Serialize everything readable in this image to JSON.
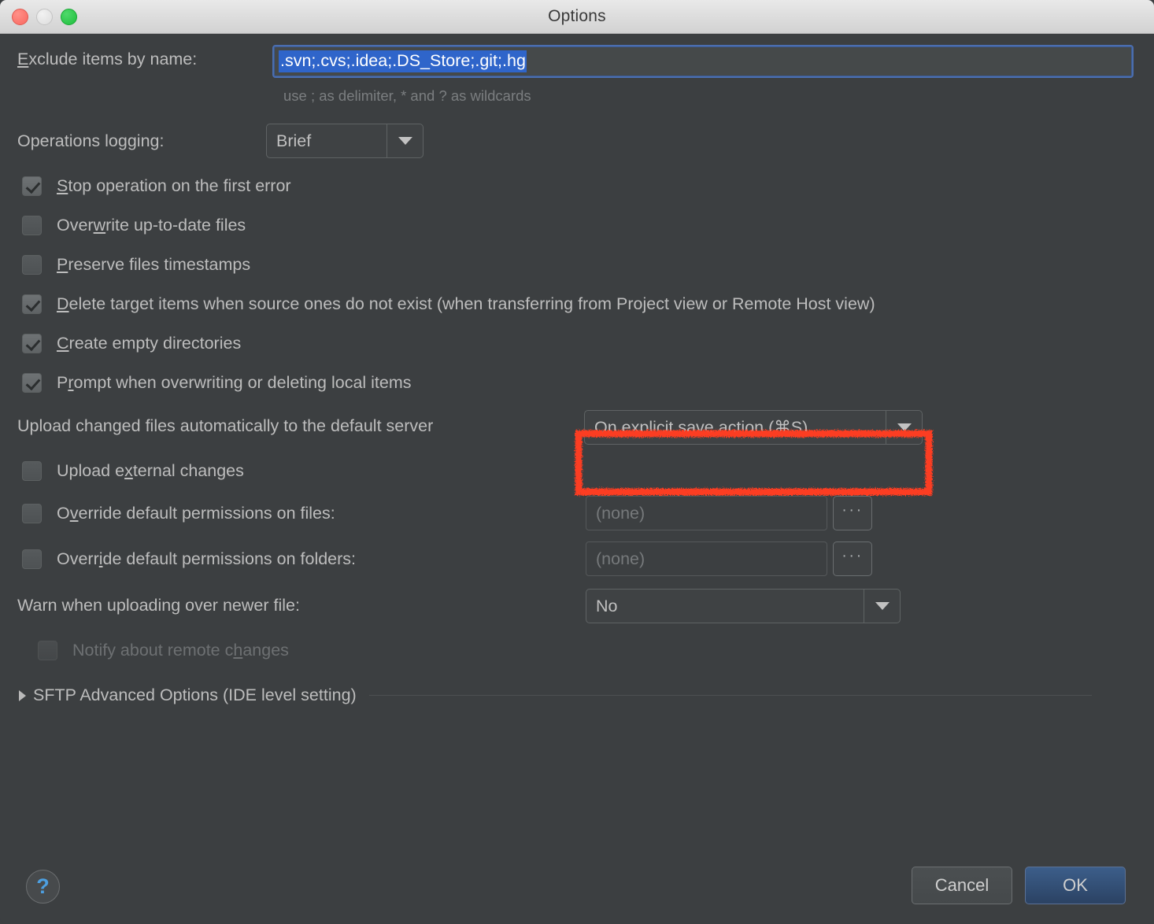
{
  "window": {
    "title": "Options",
    "traffic_lights": [
      "close",
      "minimize",
      "maximize"
    ]
  },
  "exclude": {
    "label_prefix": "E",
    "label_rest": "xclude items by name:",
    "value": ".svn;.cvs;.idea;.DS_Store;.git;.hg",
    "hint": "use ; as delimiter, * and ? as wildcards",
    "selected": true
  },
  "operations_logging": {
    "label": "Operations logging:",
    "value": "Brief"
  },
  "checkboxes": [
    {
      "mnemonic": "S",
      "prefix": "",
      "rest": "top operation on the first error",
      "checked": true,
      "disabled": false,
      "name": "stop-operation-on-first-error"
    },
    {
      "mnemonic": "w",
      "prefix": "Over",
      "rest": "rite up-to-date files",
      "checked": false,
      "disabled": false,
      "name": "overwrite-up-to-date-files"
    },
    {
      "mnemonic": "P",
      "prefix": "",
      "rest": "reserve files timestamps",
      "checked": false,
      "disabled": false,
      "name": "preserve-files-timestamps"
    },
    {
      "mnemonic": "D",
      "prefix": "",
      "rest": "elete target items when source ones do not exist (when transferring from Project view or Remote Host view)",
      "checked": true,
      "disabled": false,
      "name": "delete-target-items"
    },
    {
      "mnemonic": "C",
      "prefix": "",
      "rest": "reate empty directories",
      "checked": true,
      "disabled": false,
      "name": "create-empty-directories"
    },
    {
      "mnemonic": "r",
      "prefix": "P",
      "rest": "ompt when overwriting or deleting local items",
      "checked": true,
      "disabled": false,
      "name": "prompt-when-overwriting"
    }
  ],
  "upload_auto": {
    "label": "Upload changed files automatically to the default server",
    "value": "On explicit save action (⌘S)",
    "highlighted": true,
    "highlight_color": "#fc3d21"
  },
  "upload_external": {
    "prefix": "Upload e",
    "mnemonic": "x",
    "rest": "ternal changes",
    "checked": false
  },
  "override_files": {
    "prefix": "O",
    "mnemonic": "v",
    "rest": "erride default permissions on files:",
    "checked": false,
    "value": "(none)",
    "browse_label": "···"
  },
  "override_folders": {
    "prefix": "Overr",
    "mnemonic": "i",
    "rest": "de default permissions on folders:",
    "checked": false,
    "value": "(none)",
    "browse_label": "···"
  },
  "warn_newer": {
    "label": "Warn when uploading over newer file:",
    "value": "No"
  },
  "notify_remote": {
    "prefix": "Notify about remote c",
    "mnemonic": "h",
    "rest": "anges",
    "checked": false,
    "disabled": true
  },
  "advanced": {
    "label": "SFTP Advanced Options (IDE level setting)",
    "expanded": false
  },
  "footer": {
    "help_label": "?",
    "cancel_label": "Cancel",
    "ok_label": "OK"
  }
}
